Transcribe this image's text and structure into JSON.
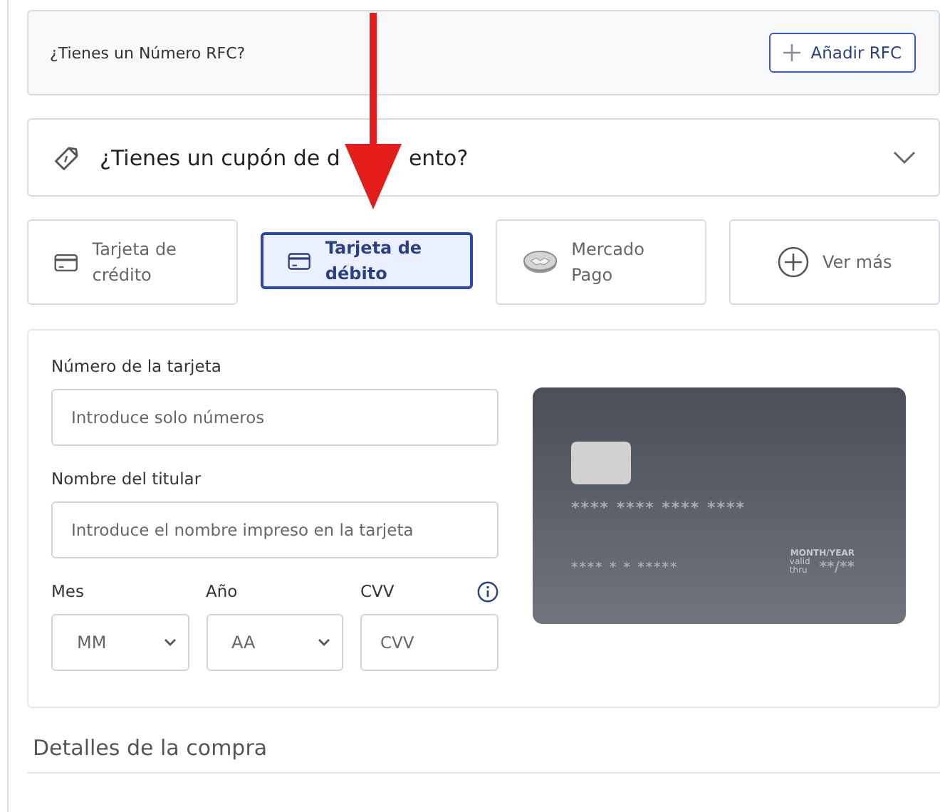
{
  "rfc": {
    "question": "¿Tienes un Número RFC?",
    "button": "Añadir RFC"
  },
  "coupon": {
    "label_start": "¿Tienes un cupón de d",
    "label_end": "ento?",
    "expanded": false
  },
  "payment_methods": [
    {
      "kind": "card",
      "label": "Tarjeta de crédito",
      "selected": false
    },
    {
      "kind": "card",
      "label": "Tarjeta de débito",
      "selected": true
    },
    {
      "kind": "wallet",
      "label": "Mercado Pago",
      "selected": false
    },
    {
      "kind": "more",
      "label": "Ver más",
      "selected": false
    }
  ],
  "form": {
    "card_number": {
      "label": "Número de la tarjeta",
      "placeholder": "Introduce solo números"
    },
    "holder": {
      "label": "Nombre del titular",
      "placeholder": "Introduce el nombre impreso en la tarjeta"
    },
    "month": {
      "label": "Mes",
      "placeholder": "MM"
    },
    "year": {
      "label": "Año",
      "placeholder": "AA"
    },
    "cvv": {
      "label": "CVV",
      "placeholder": "CVV"
    }
  },
  "card_preview": {
    "number": "**** **** **** ****",
    "name": "**** * * *****",
    "expiry_caption": "MONTH/YEAR",
    "valid_thru": "valid thru",
    "expiry": "**/**"
  },
  "details": {
    "title": "Detalles de la compra"
  }
}
